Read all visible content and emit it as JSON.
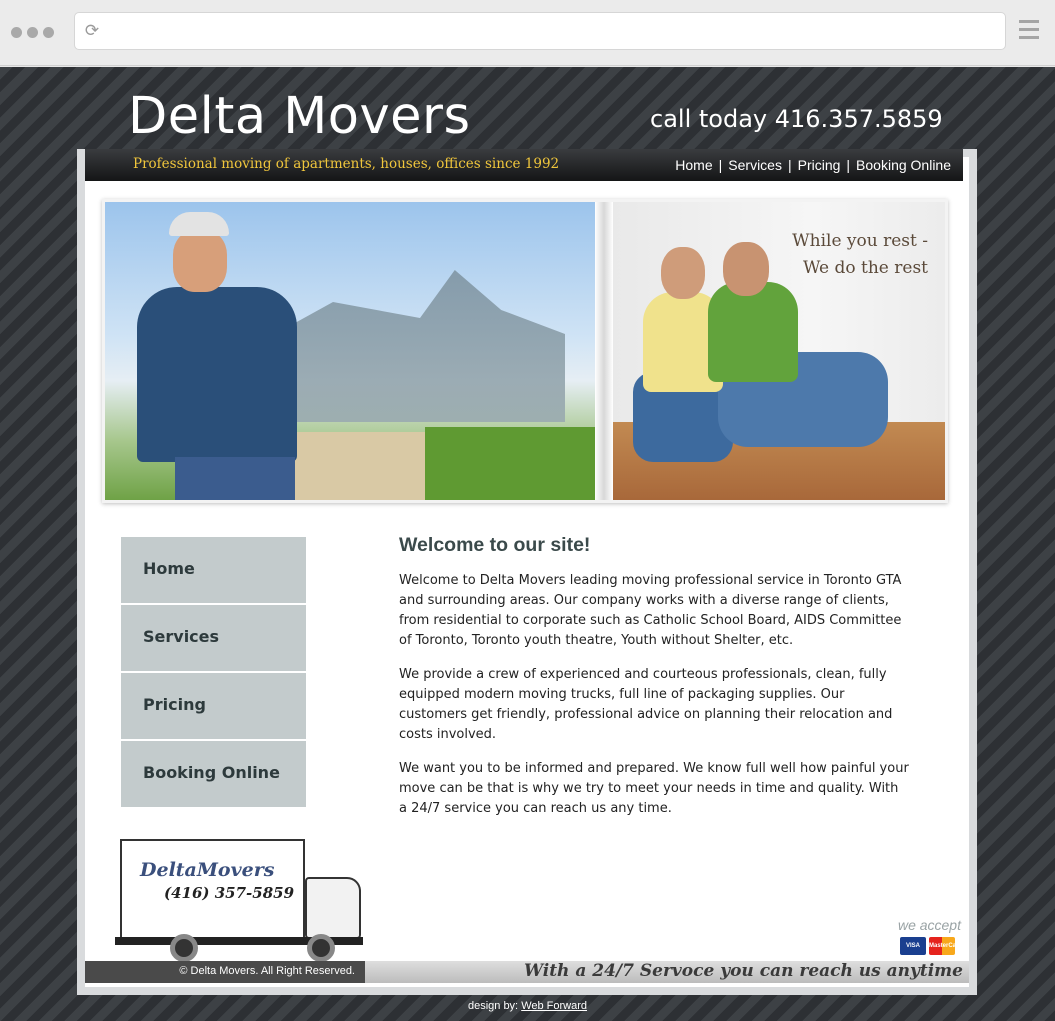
{
  "header": {
    "brand": "Delta Movers",
    "call": "call today 416.357.5859",
    "tagline": "Professional moving of apartments, houses, offices since 1992"
  },
  "topnav": {
    "items": [
      {
        "label": "Home"
      },
      {
        "label": "Services"
      },
      {
        "label": "Pricing"
      },
      {
        "label": "Booking Online"
      }
    ],
    "separator": "|"
  },
  "hero": {
    "slogan_line1": "While you rest -",
    "slogan_line2": "We do the rest"
  },
  "sidenav": {
    "items": [
      {
        "label": "Home"
      },
      {
        "label": "Services"
      },
      {
        "label": "Pricing"
      },
      {
        "label": "Booking Online"
      }
    ]
  },
  "content": {
    "title": "Welcome to our site!",
    "paragraphs": [
      "Welcome to Delta Movers leading moving professional service in Toronto GTA and surrounding areas. Our company works with a diverse range of clients, from residential to corporate such as Catholic School Board, AIDS Committee of Toronto, Toronto youth theatre, Youth without Shelter, etc.",
      "We provide a crew of experienced and courteous professionals, clean, fully equipped modern moving trucks, full line of packaging supplies. Our customers get friendly, professional advice on planning their relocation and costs involved.",
      "We want you to be informed and prepared. We know full well how painful your move can be that is why we try to meet your needs in time and quality. With a 24/7 service you can reach us any time."
    ]
  },
  "truck": {
    "brand": "DeltaMovers",
    "phone": "(416) 357-5859"
  },
  "payment": {
    "label": "we accept",
    "cards": [
      "VISA",
      "MasterCard"
    ]
  },
  "footer": {
    "copyright": "© Delta Movers. All Right Reserved.",
    "motto": "With a 24/7 Servoce you can reach us anytime",
    "design_prefix": "design by:",
    "design_link": "Web Forward"
  },
  "colors": {
    "tagline": "#f0c63c",
    "sidenav_bg": "#c3cbcc",
    "page_bg": "#34373b"
  }
}
